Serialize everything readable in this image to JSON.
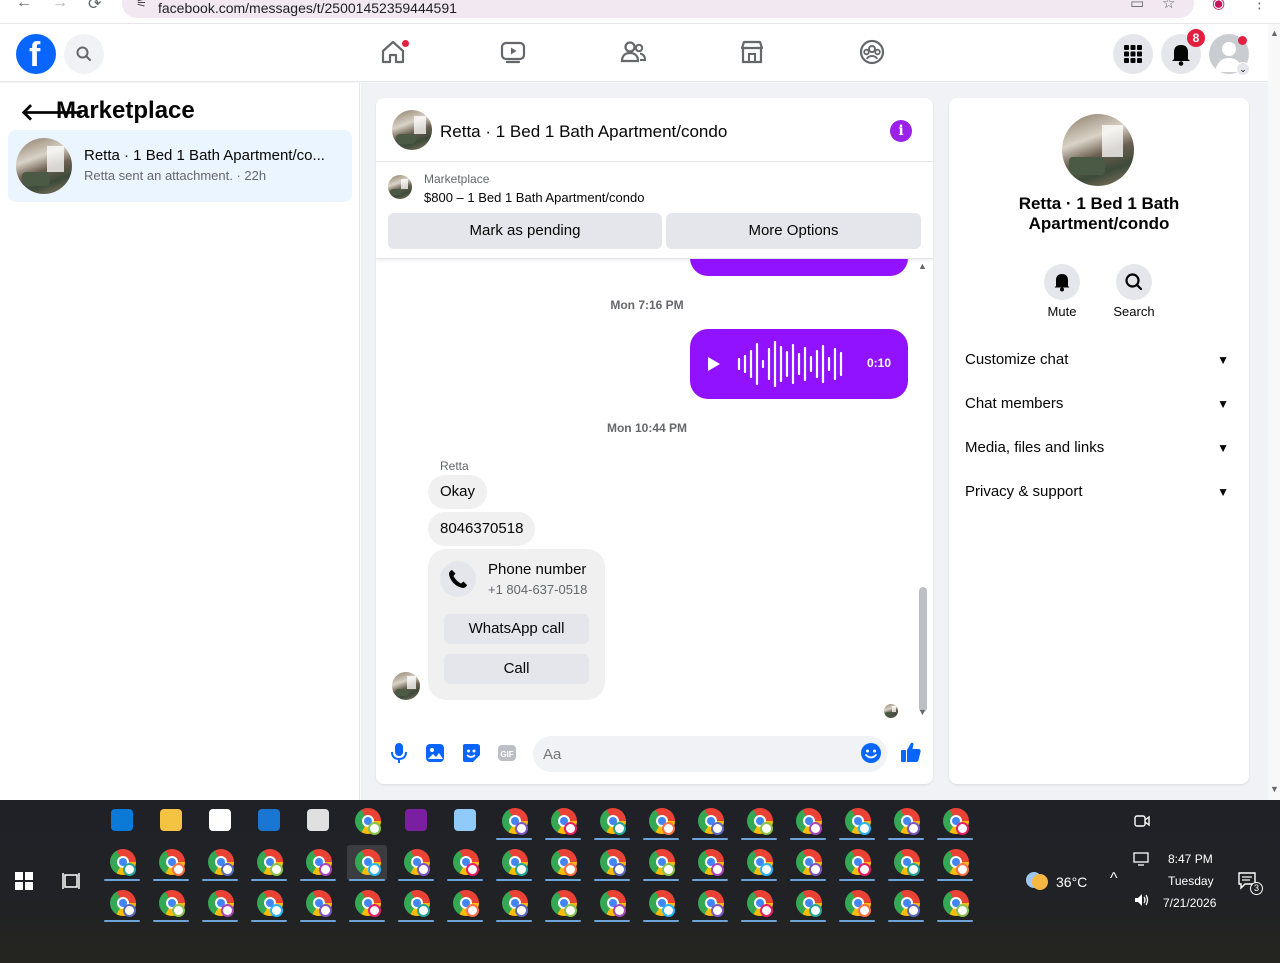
{
  "browser": {
    "url": "facebook.com/messages/t/25001452359444591"
  },
  "topnav": {
    "notification_count": "8"
  },
  "sidebar": {
    "title": "Marketplace",
    "thread": {
      "name": "Retta · 1 Bed 1 Bath Apartment/co...",
      "preview": "Retta sent an attachment. · 22h"
    }
  },
  "chat": {
    "title": "Retta · 1 Bed 1 Bath Apartment/condo",
    "marketplace_label": "Marketplace",
    "listing": "$800 – 1 Bed 1 Bath Apartment/condo",
    "mark_pending": "Mark as pending",
    "more_options": "More Options",
    "messages": {
      "ts1": "Mon 7:16 PM",
      "voice_duration": "0:10",
      "ts2": "Mon 10:44 PM",
      "sender": "Retta",
      "msg1": "Okay",
      "msg2": "8046370518",
      "phone_card": {
        "title": "Phone number",
        "number": "+1 804-637-0518",
        "whatsapp": "WhatsApp call",
        "call": "Call"
      }
    },
    "composer_placeholder": "Aa"
  },
  "rightpanel": {
    "title": "Retta · 1 Bed 1 Bath Apartment/condo",
    "mute": "Mute",
    "search": "Search",
    "sections": [
      "Customize chat",
      "Chat members",
      "Media, files and links",
      "Privacy & support"
    ]
  },
  "taskbar": {
    "weather": "36°C",
    "time": "8:47 PM",
    "day": "Tuesday",
    "date": "7/21/2026",
    "action_center_count": "3"
  }
}
